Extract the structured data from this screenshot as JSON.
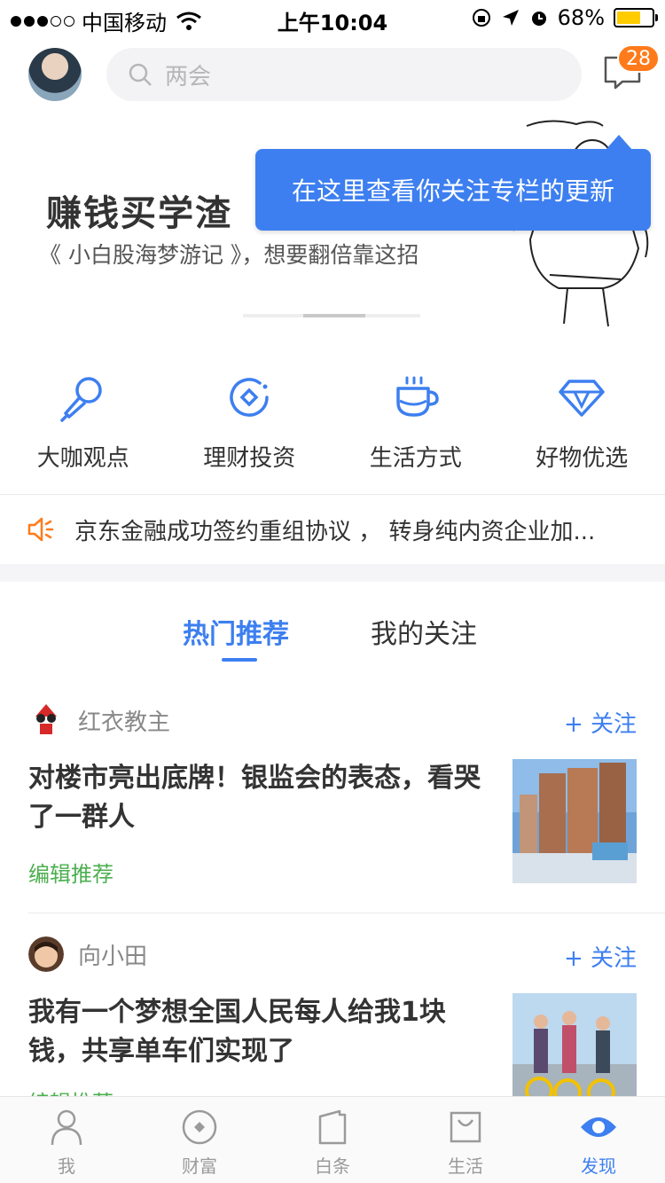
{
  "status_bar": {
    "carrier": "中国移动",
    "time": "上午10:04",
    "battery": "68%",
    "battery_level": 0.68
  },
  "header": {
    "search_placeholder": "两会",
    "message_badge": "28"
  },
  "banner": {
    "title": "赚钱买学渣",
    "subtitle": "《 小白股海梦游记 》，想要翻倍靠这招",
    "tooltip": "在这里查看你关注专栏的更新"
  },
  "quick_links": [
    {
      "label": "大咖观点",
      "icon": "microphone-icon"
    },
    {
      "label": "理财投资",
      "icon": "coin-icon"
    },
    {
      "label": "生活方式",
      "icon": "coffee-cup-icon"
    },
    {
      "label": "好物优选",
      "icon": "diamond-icon"
    }
  ],
  "ticker": {
    "text": "京东金融成功签约重组协议 ， 转身纯内资企业加..."
  },
  "tabs": {
    "hot": "热门推荐",
    "following": "我的关注"
  },
  "feed": [
    {
      "author": "红衣教主",
      "follow": "+ 关注",
      "headline": "对楼市亮出底牌！银监会的表态，看哭了一群人",
      "tag": "编辑推荐"
    },
    {
      "author": "向小田",
      "follow": "+ 关注",
      "headline": "我有一个梦想全国人民每人给我1块钱，共享单车们实现了",
      "tag": "编辑推荐"
    }
  ],
  "bottom_nav": [
    {
      "label": "我"
    },
    {
      "label": "财富"
    },
    {
      "label": "白条"
    },
    {
      "label": "生活"
    },
    {
      "label": "发现"
    }
  ],
  "colors": {
    "accent": "#3d7ff0",
    "badge": "#ff7a1a",
    "tag_green": "#4caf50",
    "battery": "#ffcc00"
  }
}
